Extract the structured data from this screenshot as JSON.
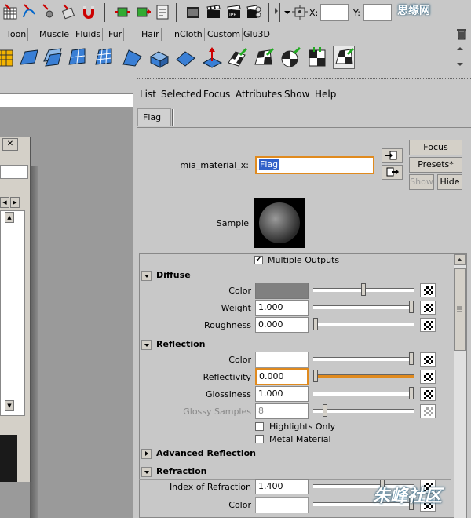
{
  "toolbar": {
    "x_label": "X:",
    "y_label": "Y:"
  },
  "shelf_tabs": [
    "Toon",
    "Muscle",
    "Fluids",
    "Fur",
    "Hair",
    "nCloth",
    "Custom",
    "Glu3D"
  ],
  "attribute_editor": {
    "menu": [
      "List",
      "Selected",
      "Focus",
      "Attributes",
      "Show",
      "Help"
    ],
    "tab": "Flag",
    "node_label": "mia_material_x:",
    "node_name": "Flag",
    "buttons": {
      "focus": "Focus",
      "presets": "Presets*",
      "show": "Show",
      "hide": "Hide"
    },
    "sample_label": "Sample",
    "multiple_outputs_label": "Multiple Outputs",
    "multiple_outputs_checked": true,
    "sections": {
      "diffuse": {
        "title": "Diffuse",
        "color_label": "Color",
        "color_value": "#808080",
        "weight_label": "Weight",
        "weight_value": "1.000",
        "roughness_label": "Roughness",
        "roughness_value": "0.000"
      },
      "reflection": {
        "title": "Reflection",
        "color_label": "Color",
        "color_value": "#ffffff",
        "reflectivity_label": "Reflectivity",
        "reflectivity_value": "0.000",
        "glossiness_label": "Glossiness",
        "glossiness_value": "1.000",
        "glossy_samples_label": "Glossy Samples",
        "glossy_samples_value": "8",
        "highlights_only_label": "Highlights Only",
        "metal_material_label": "Metal Material"
      },
      "advanced_reflection": {
        "title": "Advanced Reflection"
      },
      "refraction": {
        "title": "Refraction",
        "ior_label": "Index of Refraction",
        "ior_value": "1.400",
        "color_label": "Color",
        "color_value": "#ffffff"
      }
    },
    "slider_levels": {
      "diffuse_color": 0.5,
      "diffuse_weight": 1.0,
      "diffuse_roughness": 0.0,
      "reflection_color": 1.0,
      "reflectivity": 0.0,
      "glossiness": 1.0,
      "glossy_samples": 0.1,
      "ior": 0.7,
      "refraction_color": 1.0
    }
  },
  "colors": {
    "accent_orange": "#e08a1e",
    "panel_bg": "#c8c8c8"
  },
  "watermarks": [
    "思缘网",
    "朱峰社区"
  ]
}
